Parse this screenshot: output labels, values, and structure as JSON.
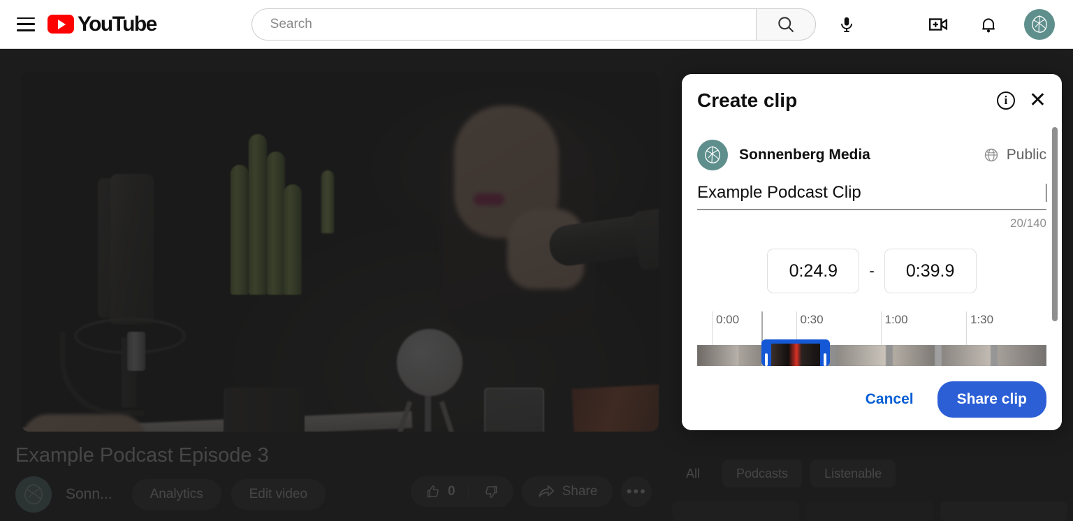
{
  "header": {
    "menu_icon": "hamburger-menu-icon",
    "logo_text": "YouTube",
    "logo_icon": "youtube-play-icon",
    "search": {
      "value": "",
      "placeholder": "Search",
      "icon": "search-icon"
    },
    "voice_search_icon": "microphone-icon",
    "create_icon": "create-video-icon",
    "notifications_icon": "bell-icon",
    "account_avatar": "user-avatar"
  },
  "watch": {
    "video_title": "Example Podcast Episode 3",
    "channel_name": "Sonn...",
    "channel_avatar": "channel-avatar",
    "analytics_label": "Analytics",
    "edit_video_label": "Edit video",
    "like_count": "0",
    "like_icon": "thumbs-up-icon",
    "dislike_icon": "thumbs-down-icon",
    "share_label": "Share",
    "share_icon": "share-arrow-icon",
    "more_label": "•••"
  },
  "sidebar": {
    "chips": [
      {
        "label": "All",
        "active": true
      },
      {
        "label": "Podcasts",
        "active": false
      },
      {
        "label": "Listenable",
        "active": false
      }
    ]
  },
  "dialog": {
    "title": "Create clip",
    "info_icon": "info-circle-icon",
    "close_icon": "close-x-icon",
    "owner_name": "Sonnenberg Media",
    "owner_avatar": "channel-avatar",
    "visibility_label": "Public",
    "visibility_icon": "globe-icon",
    "clip_title_value": "Example Podcast Clip",
    "clip_title_placeholder": "Add a title",
    "char_count": "20/140",
    "start_time": "0:24.9",
    "time_separator": "-",
    "end_time": "0:39.9",
    "timeline": {
      "ticks": [
        {
          "label": "0:00",
          "pos_pct": 4.2
        },
        {
          "label": "0:30",
          "pos_pct": 28.3
        },
        {
          "label": "1:00",
          "pos_pct": 52.5
        },
        {
          "label": "1:30",
          "pos_pct": 77.0
        }
      ],
      "selection_start_pct": 18.3,
      "selection_width_pct": 19.6
    },
    "cancel_label": "Cancel",
    "share_clip_label": "Share clip"
  },
  "colors": {
    "brand_red": "#ff0000",
    "accent_blue": "#065fd4",
    "button_blue": "#2c5fd6",
    "selection_blue": "#1558d6",
    "avatar_teal": "#5f8f8c",
    "page_dark": "#0f0f0f"
  }
}
